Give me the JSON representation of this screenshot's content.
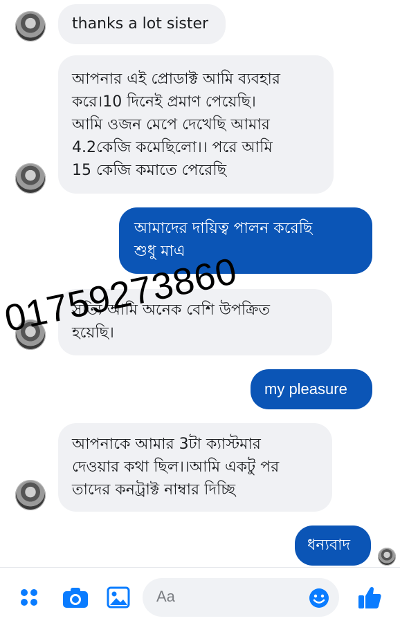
{
  "messages": [
    {
      "text": "thanks a lot sister"
    },
    {
      "text": "আপনার এই প্রোডাক্ট আমি ব্যবহার\nকরে।10 দিনেই প্রমাণ পেয়েছি।\nআমি ওজন মেপে দেখেছি আমার\n4.2কেজি কমেছিলো।। পরে আমি\n15 কেজি কমাতে পেরেছি"
    },
    {
      "text": "আমাদের দায়িত্ব পালন করেছি\nশুধু মাএ"
    },
    {
      "text": "সত্যি আমি অনেক বেশি উপক্রিত\nহয়েছি।"
    },
    {
      "text": "my pleasure"
    },
    {
      "text": "আপনাকে আমার 3টা ক্যাস্টমার\nদেওয়ার কথা ছিল।।আমি একটু পর\nতাদের কনট্রাক্ট  নাম্বার দিচ্ছি"
    },
    {
      "text": "ধন্যবাদ"
    }
  ],
  "watermark": "01759273860",
  "composer": {
    "placeholder": "Aa",
    "icons": [
      "apps-icon",
      "camera-icon",
      "gallery-icon",
      "emoji-icon",
      "thumbs-up-icon"
    ]
  },
  "colors": {
    "incoming_bubble": "#f0f1f4",
    "outgoing_bubble": "#0b55b6",
    "accent": "#0a7cff"
  }
}
